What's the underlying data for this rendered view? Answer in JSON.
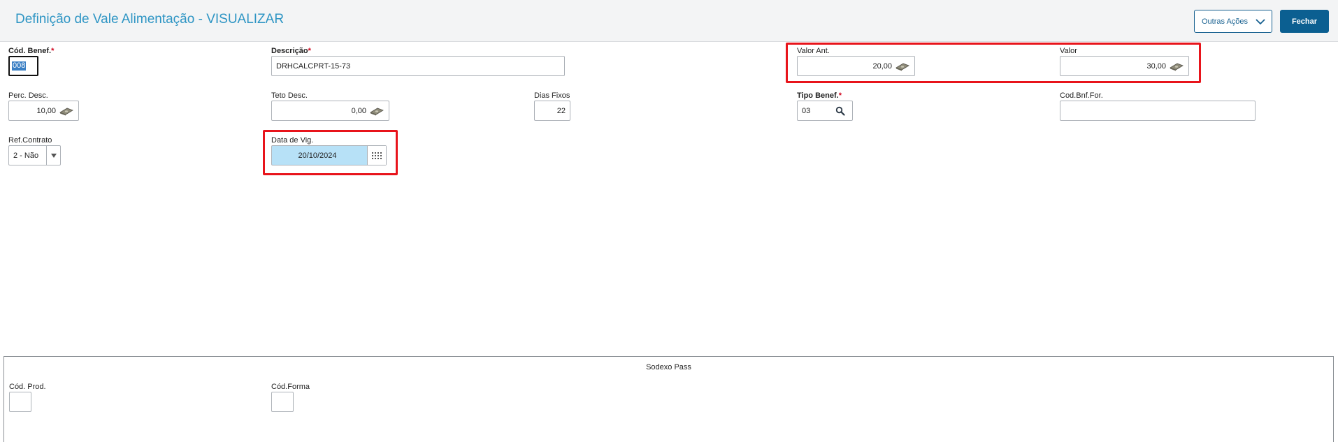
{
  "header": {
    "title": "Definição de Vale Alimentação - VISUALIZAR",
    "other_actions_label": "Outras Ações",
    "close_label": "Fechar"
  },
  "fields": {
    "cod_benef": {
      "label": "Cód. Benef.",
      "required_mark": "*",
      "value": "008"
    },
    "descricao": {
      "label": "Descrição",
      "required_mark": "*",
      "value": "DRHCALCPRT-15-73"
    },
    "valor_ant": {
      "label": "Valor Ant.",
      "value": "20,00"
    },
    "valor": {
      "label": "Valor",
      "value": "30,00"
    },
    "perc_desc": {
      "label": "Perc. Desc.",
      "value": "10,00"
    },
    "teto_desc": {
      "label": "Teto Desc.",
      "value": "0,00"
    },
    "dias_fixos": {
      "label": "Dias Fixos",
      "value": "22"
    },
    "tipo_benef": {
      "label": "Tipo Benef.",
      "required_mark": "*",
      "value": "03"
    },
    "cod_bnf_for": {
      "label": "Cod.Bnf.For.",
      "value": ""
    },
    "ref_contrato": {
      "label": "Ref.Contrato",
      "value": "2 - Não"
    },
    "data_vig": {
      "label": "Data de Vig.",
      "value": "20/10/2024"
    }
  },
  "sodexo": {
    "title": "Sodexo Pass",
    "cod_prod": {
      "label": "Cód. Prod.",
      "value": ""
    },
    "cod_forma": {
      "label": "Cód.Forma",
      "value": ""
    }
  },
  "icons": {
    "money": "money-icon",
    "search": "magnifier-icon",
    "calendar": "calendar-icon",
    "dropdown": "chevron-down-icon"
  },
  "colors": {
    "title": "#2e95c4",
    "primary_button": "#0b5f91",
    "highlight": "#e8141b",
    "date_field_bg": "#b7e1f7",
    "required": "#d0021b"
  }
}
